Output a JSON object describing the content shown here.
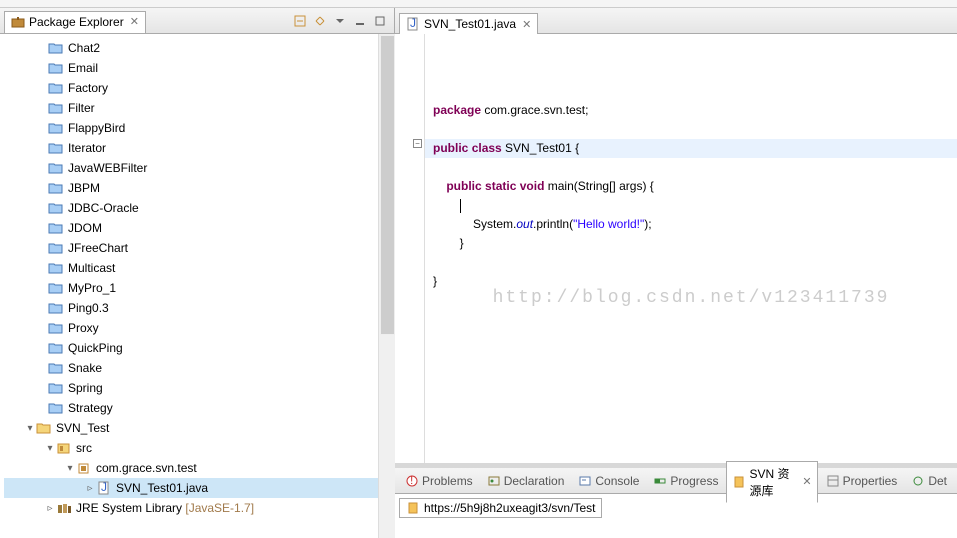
{
  "packageExplorer": {
    "title": "Package Explorer",
    "items": [
      {
        "label": "Chat2",
        "indent": 32,
        "twisty": "",
        "icon": "folder"
      },
      {
        "label": "Email",
        "indent": 32,
        "twisty": "",
        "icon": "folder"
      },
      {
        "label": "Factory",
        "indent": 32,
        "twisty": "",
        "icon": "folder"
      },
      {
        "label": "Filter",
        "indent": 32,
        "twisty": "",
        "icon": "folder"
      },
      {
        "label": "FlappyBird",
        "indent": 32,
        "twisty": "",
        "icon": "folder"
      },
      {
        "label": "Iterator",
        "indent": 32,
        "twisty": "",
        "icon": "folder"
      },
      {
        "label": "JavaWEBFilter",
        "indent": 32,
        "twisty": "",
        "icon": "folder"
      },
      {
        "label": "JBPM",
        "indent": 32,
        "twisty": "",
        "icon": "folder"
      },
      {
        "label": "JDBC-Oracle",
        "indent": 32,
        "twisty": "",
        "icon": "folder"
      },
      {
        "label": "JDOM",
        "indent": 32,
        "twisty": "",
        "icon": "folder"
      },
      {
        "label": "JFreeChart",
        "indent": 32,
        "twisty": "",
        "icon": "folder"
      },
      {
        "label": "Multicast",
        "indent": 32,
        "twisty": "",
        "icon": "folder"
      },
      {
        "label": "MyPro_1",
        "indent": 32,
        "twisty": "",
        "icon": "folder"
      },
      {
        "label": "Ping0.3",
        "indent": 32,
        "twisty": "",
        "icon": "folder"
      },
      {
        "label": "Proxy",
        "indent": 32,
        "twisty": "",
        "icon": "folder"
      },
      {
        "label": "QuickPing",
        "indent": 32,
        "twisty": "",
        "icon": "folder"
      },
      {
        "label": "Snake",
        "indent": 32,
        "twisty": "",
        "icon": "folder"
      },
      {
        "label": "Spring",
        "indent": 32,
        "twisty": "",
        "icon": "folder"
      },
      {
        "label": "Strategy",
        "indent": 32,
        "twisty": "",
        "icon": "folder"
      },
      {
        "label": "SVN_Test",
        "indent": 20,
        "twisty": "▾",
        "icon": "project"
      },
      {
        "label": "src",
        "indent": 40,
        "twisty": "▾",
        "icon": "src"
      },
      {
        "label": "com.grace.svn.test",
        "indent": 60,
        "twisty": "▾",
        "icon": "package"
      },
      {
        "label": "SVN_Test01.java",
        "indent": 80,
        "twisty": "▹",
        "icon": "java",
        "selected": true
      },
      {
        "label": "JRE System Library",
        "decor": " [JavaSE-1.7]",
        "indent": 40,
        "twisty": "▹",
        "icon": "lib"
      }
    ]
  },
  "editor": {
    "tab": "SVN_Test01.java",
    "code": {
      "l1a": "package",
      "l1b": " com.grace.svn.test;",
      "l3a": "public",
      "l3b": " ",
      "l3c": "class",
      "l3d": " SVN_Test01 {",
      "l5a": "public",
      "l5b": " ",
      "l5c": "static",
      "l5d": " ",
      "l5e": "void",
      "l5f": " main(String[] args) {",
      "l7a": "            System.",
      "l7b": "out",
      "l7c": ".println(",
      "l7d": "\"Hello world!\"",
      "l7e": ");",
      "l8": "        }",
      "l10": "}"
    }
  },
  "bottomTabs": {
    "problems": "Problems",
    "declaration": "Declaration",
    "console": "Console",
    "progress": "Progress",
    "svn": "SVN 资源库",
    "properties": "Properties",
    "det": "Det"
  },
  "svnUrl": "https://5h9j8h2uxeagit3/svn/Test",
  "watermark": "http://blog.csdn.net/v123411739"
}
